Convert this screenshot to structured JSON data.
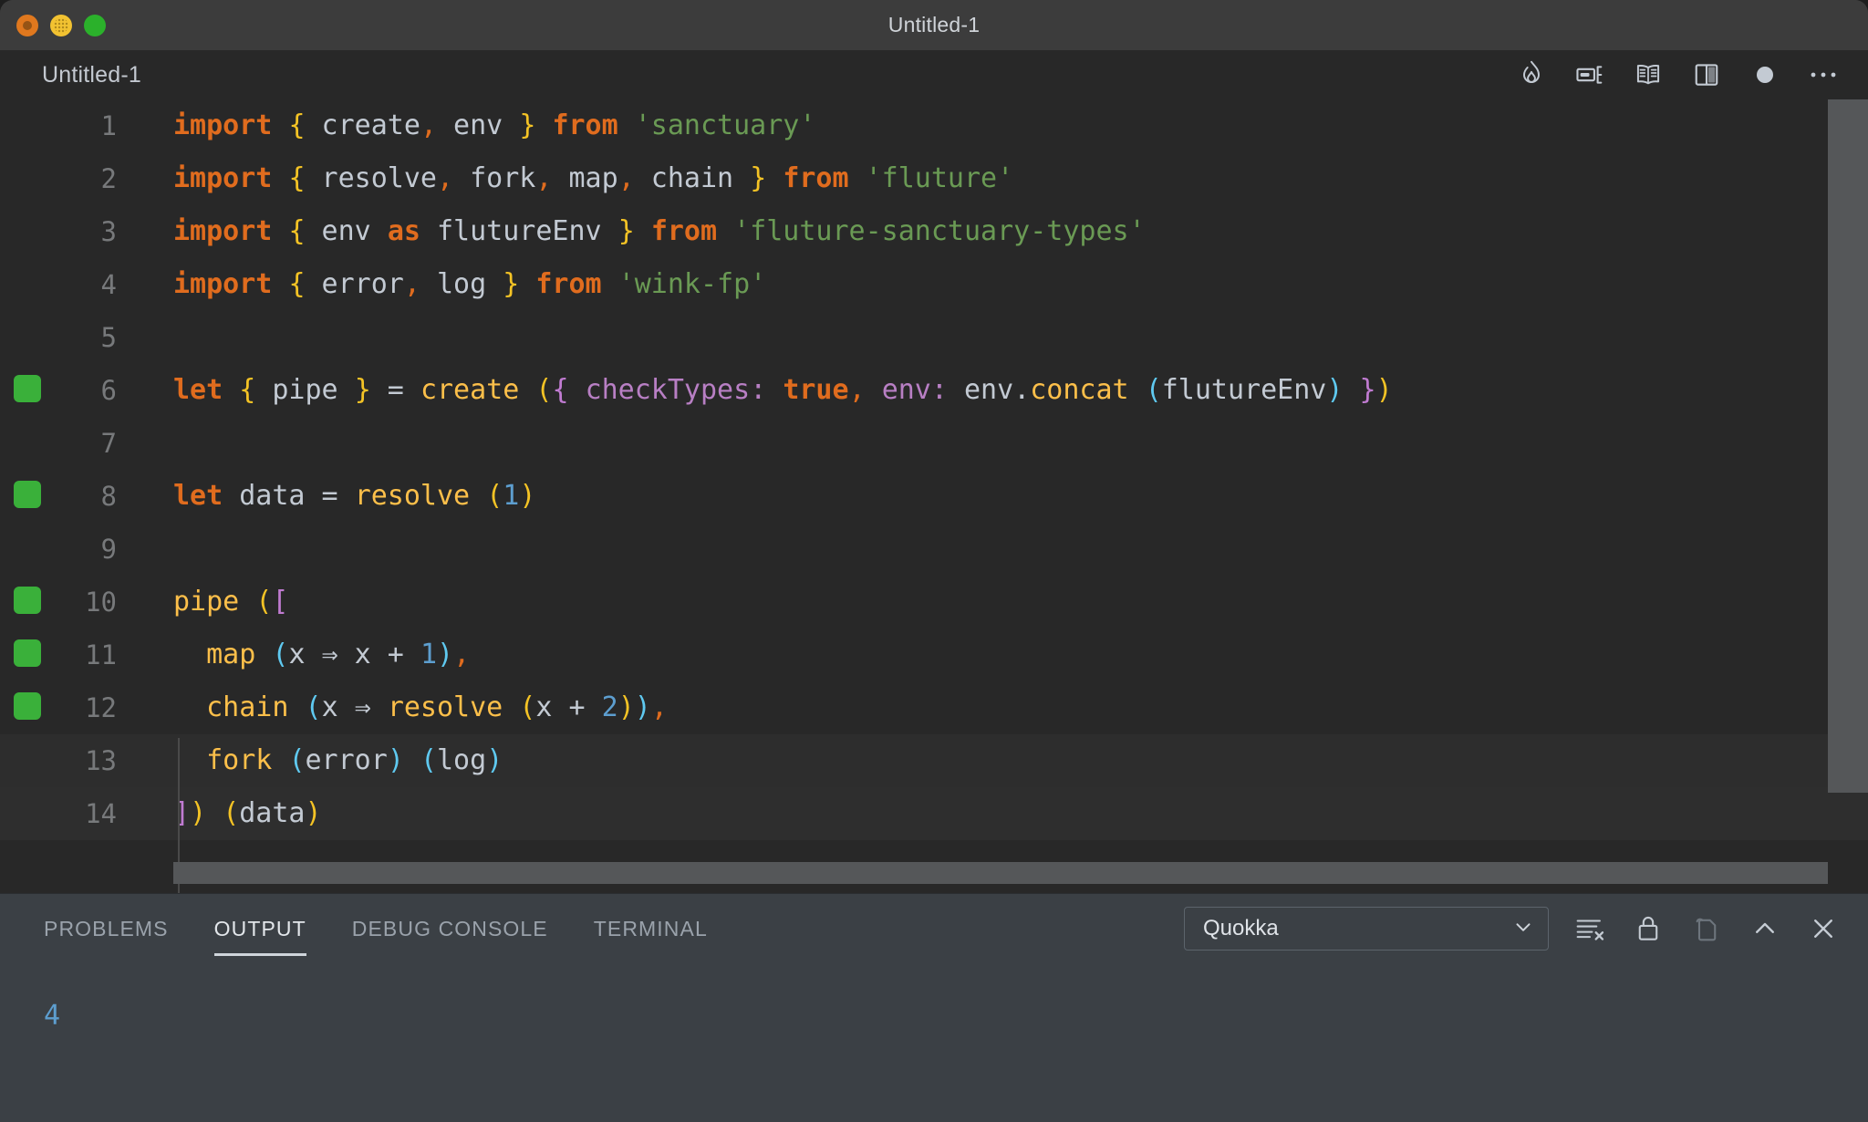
{
  "window": {
    "title": "Untitled-1",
    "traffic_lights": [
      {
        "name": "close-button",
        "color": "#e0781e"
      },
      {
        "name": "minimize-button",
        "color": "#f2c231"
      },
      {
        "name": "maximize-button",
        "color": "#2bb12b"
      }
    ]
  },
  "editor": {
    "tab_title": "Untitled-1",
    "actions": [
      {
        "name": "quokka-flame-icon",
        "label": "Quokka"
      },
      {
        "name": "run-code-icon",
        "label": "Run"
      },
      {
        "name": "open-preview-icon",
        "label": "Open Preview"
      },
      {
        "name": "split-editor-icon",
        "label": "Split Editor"
      },
      {
        "name": "unsaved-dot-icon",
        "label": "Unsaved"
      },
      {
        "name": "more-actions-icon",
        "label": "More Actions..."
      }
    ],
    "language": "javascript",
    "colors": {
      "background": "#282828",
      "keyword": "#e06c1e",
      "identifier": "#c3cad3",
      "string": "#6a9a54",
      "number": "#5d9ecf",
      "function": "#fcbf4a",
      "property": "#b87fc4",
      "bracket_yellow": "#f4c325",
      "bracket_magenta": "#c07bd1",
      "bracket_cyan": "#5fc9f0",
      "coverage_marker": "#3ab03a",
      "line_number": "#77797b"
    },
    "lines": [
      {
        "number": "1",
        "covered": true,
        "marker": false,
        "tokens": [
          {
            "t": "import",
            "c": "t-key"
          },
          {
            "t": " ",
            "c": "t-op"
          },
          {
            "t": "{",
            "c": "b-yel"
          },
          {
            "t": " create",
            "c": "t-id"
          },
          {
            "t": ",",
            "c": "t-comma"
          },
          {
            "t": " env ",
            "c": "t-id"
          },
          {
            "t": "}",
            "c": "b-yel"
          },
          {
            "t": " ",
            "c": "t-op"
          },
          {
            "t": "from",
            "c": "t-key"
          },
          {
            "t": " ",
            "c": "t-op"
          },
          {
            "t": "'sanctuary'",
            "c": "t-str"
          }
        ]
      },
      {
        "number": "2",
        "covered": true,
        "marker": false,
        "tokens": [
          {
            "t": "import",
            "c": "t-key"
          },
          {
            "t": " ",
            "c": "t-op"
          },
          {
            "t": "{",
            "c": "b-yel"
          },
          {
            "t": " resolve",
            "c": "t-id"
          },
          {
            "t": ",",
            "c": "t-comma"
          },
          {
            "t": " fork",
            "c": "t-id"
          },
          {
            "t": ",",
            "c": "t-comma"
          },
          {
            "t": " map",
            "c": "t-id"
          },
          {
            "t": ",",
            "c": "t-comma"
          },
          {
            "t": " chain ",
            "c": "t-id"
          },
          {
            "t": "}",
            "c": "b-yel"
          },
          {
            "t": " ",
            "c": "t-op"
          },
          {
            "t": "from",
            "c": "t-key"
          },
          {
            "t": " ",
            "c": "t-op"
          },
          {
            "t": "'fluture'",
            "c": "t-str"
          }
        ]
      },
      {
        "number": "3",
        "covered": true,
        "marker": false,
        "tokens": [
          {
            "t": "import",
            "c": "t-key"
          },
          {
            "t": " ",
            "c": "t-op"
          },
          {
            "t": "{",
            "c": "b-yel"
          },
          {
            "t": " env ",
            "c": "t-id"
          },
          {
            "t": "as",
            "c": "t-key"
          },
          {
            "t": " flutureEnv ",
            "c": "t-id"
          },
          {
            "t": "}",
            "c": "b-yel"
          },
          {
            "t": " ",
            "c": "t-op"
          },
          {
            "t": "from",
            "c": "t-key"
          },
          {
            "t": " ",
            "c": "t-op"
          },
          {
            "t": "'fluture-sanctuary-types'",
            "c": "t-str"
          }
        ]
      },
      {
        "number": "4",
        "covered": true,
        "marker": false,
        "tokens": [
          {
            "t": "import",
            "c": "t-key"
          },
          {
            "t": " ",
            "c": "t-op"
          },
          {
            "t": "{",
            "c": "b-yel"
          },
          {
            "t": " error",
            "c": "t-id"
          },
          {
            "t": ",",
            "c": "t-comma"
          },
          {
            "t": " log ",
            "c": "t-id"
          },
          {
            "t": "}",
            "c": "b-yel"
          },
          {
            "t": " ",
            "c": "t-op"
          },
          {
            "t": "from",
            "c": "t-key"
          },
          {
            "t": " ",
            "c": "t-op"
          },
          {
            "t": "'wink-fp'",
            "c": "t-str"
          }
        ]
      },
      {
        "number": "5",
        "covered": false,
        "marker": false,
        "tokens": []
      },
      {
        "number": "6",
        "covered": true,
        "marker": true,
        "tokens": [
          {
            "t": "let",
            "c": "t-key"
          },
          {
            "t": " ",
            "c": "t-op"
          },
          {
            "t": "{",
            "c": "b-yel"
          },
          {
            "t": " pipe ",
            "c": "t-id"
          },
          {
            "t": "}",
            "c": "b-yel"
          },
          {
            "t": " = ",
            "c": "t-op"
          },
          {
            "t": "create",
            "c": "t-fn"
          },
          {
            "t": " ",
            "c": "t-op"
          },
          {
            "t": "(",
            "c": "b-yel"
          },
          {
            "t": "{",
            "c": "b-mag"
          },
          {
            "t": " ",
            "c": "t-op"
          },
          {
            "t": "checkTypes",
            "c": "t-prop"
          },
          {
            "t": ": ",
            "c": "t-prop"
          },
          {
            "t": "true",
            "c": "t-key"
          },
          {
            "t": ",",
            "c": "t-comma"
          },
          {
            "t": " ",
            "c": "t-op"
          },
          {
            "t": "env",
            "c": "t-prop"
          },
          {
            "t": ": ",
            "c": "t-prop"
          },
          {
            "t": "env",
            "c": "t-id"
          },
          {
            "t": ".",
            "c": "t-id"
          },
          {
            "t": "concat",
            "c": "t-fn"
          },
          {
            "t": " ",
            "c": "t-op"
          },
          {
            "t": "(",
            "c": "b-cya"
          },
          {
            "t": "flutureEnv",
            "c": "t-id"
          },
          {
            "t": ")",
            "c": "b-cya"
          },
          {
            "t": " ",
            "c": "t-op"
          },
          {
            "t": "}",
            "c": "b-mag"
          },
          {
            "t": ")",
            "c": "b-yel"
          }
        ]
      },
      {
        "number": "7",
        "covered": false,
        "marker": false,
        "tokens": []
      },
      {
        "number": "8",
        "covered": true,
        "marker": true,
        "tokens": [
          {
            "t": "let",
            "c": "t-key"
          },
          {
            "t": " data = ",
            "c": "t-id"
          },
          {
            "t": "resolve",
            "c": "t-fn"
          },
          {
            "t": " ",
            "c": "t-op"
          },
          {
            "t": "(",
            "c": "b-yel"
          },
          {
            "t": "1",
            "c": "t-num"
          },
          {
            "t": ")",
            "c": "b-yel"
          }
        ]
      },
      {
        "number": "9",
        "covered": false,
        "marker": false,
        "tokens": []
      },
      {
        "number": "10",
        "covered": true,
        "marker": true,
        "tokens": [
          {
            "t": "pipe",
            "c": "t-fn"
          },
          {
            "t": " ",
            "c": "t-op"
          },
          {
            "t": "(",
            "c": "b-yel"
          },
          {
            "t": "[",
            "c": "b-mag"
          }
        ]
      },
      {
        "number": "11",
        "covered": true,
        "marker": true,
        "tokens": [
          {
            "t": "  ",
            "c": "t-op"
          },
          {
            "t": "map",
            "c": "t-fn"
          },
          {
            "t": " ",
            "c": "t-op"
          },
          {
            "t": "(",
            "c": "b-cya"
          },
          {
            "t": "x ",
            "c": "t-id"
          },
          {
            "t": "⇒",
            "c": "t-op"
          },
          {
            "t": " x + ",
            "c": "t-id"
          },
          {
            "t": "1",
            "c": "t-num"
          },
          {
            "t": ")",
            "c": "b-cya"
          },
          {
            "t": ",",
            "c": "t-comma"
          }
        ]
      },
      {
        "number": "12",
        "covered": true,
        "marker": true,
        "tokens": [
          {
            "t": "  ",
            "c": "t-op"
          },
          {
            "t": "chain",
            "c": "t-fn"
          },
          {
            "t": " ",
            "c": "t-op"
          },
          {
            "t": "(",
            "c": "b-cya"
          },
          {
            "t": "x ",
            "c": "t-id"
          },
          {
            "t": "⇒",
            "c": "t-op"
          },
          {
            "t": " ",
            "c": "t-op"
          },
          {
            "t": "resolve",
            "c": "t-fn"
          },
          {
            "t": " ",
            "c": "t-op"
          },
          {
            "t": "(",
            "c": "b-yel"
          },
          {
            "t": "x + ",
            "c": "t-id"
          },
          {
            "t": "2",
            "c": "t-num"
          },
          {
            "t": ")",
            "c": "b-yel"
          },
          {
            "t": ")",
            "c": "b-cya"
          },
          {
            "t": ",",
            "c": "t-comma"
          }
        ]
      },
      {
        "number": "13",
        "covered": false,
        "marker": false,
        "current": true,
        "tokens": [
          {
            "t": "  ",
            "c": "t-op"
          },
          {
            "t": "fork",
            "c": "t-fn"
          },
          {
            "t": " ",
            "c": "t-op"
          },
          {
            "t": "(",
            "c": "b-cya"
          },
          {
            "t": "error",
            "c": "t-id"
          },
          {
            "t": ")",
            "c": "b-cya"
          },
          {
            "t": " ",
            "c": "t-op"
          },
          {
            "t": "(",
            "c": "b-cya"
          },
          {
            "t": "log",
            "c": "t-id"
          },
          {
            "t": ")",
            "c": "b-cya"
          }
        ]
      },
      {
        "number": "14",
        "covered": false,
        "marker": false,
        "alt": true,
        "tokens": [
          {
            "t": "]",
            "c": "b-mag"
          },
          {
            "t": ")",
            "c": "b-yel"
          },
          {
            "t": " ",
            "c": "t-op"
          },
          {
            "t": "(",
            "c": "b-yel"
          },
          {
            "t": "data",
            "c": "t-id"
          },
          {
            "t": ")",
            "c": "b-yel"
          }
        ]
      }
    ]
  },
  "panel": {
    "tabs": [
      {
        "label": "PROBLEMS",
        "active": false
      },
      {
        "label": "OUTPUT",
        "active": true
      },
      {
        "label": "DEBUG CONSOLE",
        "active": false
      },
      {
        "label": "TERMINAL",
        "active": false
      }
    ],
    "channel": "Quokka",
    "actions": [
      {
        "name": "clear-output-icon",
        "label": "Clear Output"
      },
      {
        "name": "lock-scroll-icon",
        "label": "Turn Auto Scrolling Off"
      },
      {
        "name": "open-in-editor-icon",
        "label": "Open Output in Editor"
      },
      {
        "name": "maximize-panel-icon",
        "label": "Maximize Panel Size"
      },
      {
        "name": "close-panel-icon",
        "label": "Close Panel"
      }
    ],
    "output_lines": [
      "4"
    ]
  }
}
